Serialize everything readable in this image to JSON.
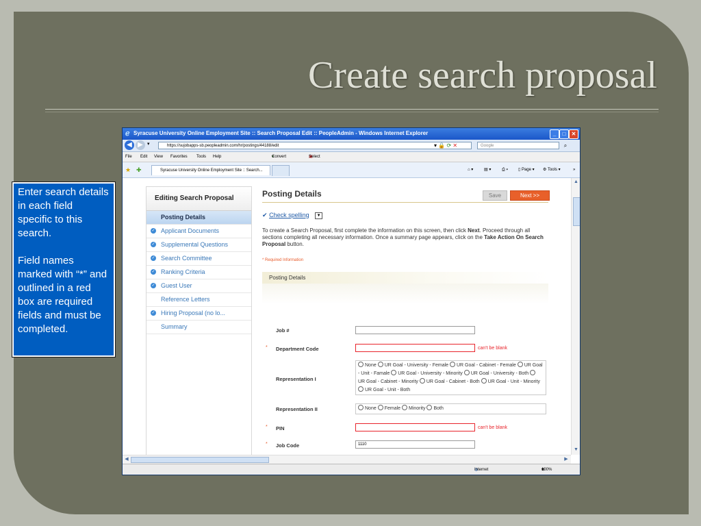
{
  "slide": {
    "title": "Create search proposal",
    "callout": {
      "para1": "Enter search details in each field specific to this search.",
      "para2": "Field names marked with “*” and outlined in a red box are required fields and must be completed."
    }
  },
  "browser": {
    "window_title": "Syracuse University Online Employment Site :: Search Proposal Edit :: PeopleAdmin - Windows Internet Explorer",
    "url": "https://sujobapps-sb.peopleadmin.com/hr/postings/44188/edit",
    "search_placeholder": "Google",
    "menu": [
      "File",
      "Edit",
      "View",
      "Favorites",
      "Tools",
      "Help"
    ],
    "convert_label": "Convert",
    "select_label": "Select",
    "tab_label": "Syracuse University Online Employment Site :: Search...",
    "commands": {
      "page": "Page",
      "tools": "Tools"
    },
    "status": {
      "zone": "Internet",
      "zoom": "100%"
    }
  },
  "sidenav": {
    "header": "Editing Search Proposal",
    "items": [
      {
        "label": "Posting Details",
        "state": "active"
      },
      {
        "label": "Applicant Documents",
        "state": "done"
      },
      {
        "label": "Supplemental Questions",
        "state": "done"
      },
      {
        "label": "Search Committee",
        "state": "done"
      },
      {
        "label": "Ranking Criteria",
        "state": "done"
      },
      {
        "label": "Guest User",
        "state": "done"
      },
      {
        "label": "Reference Letters",
        "state": "plain"
      },
      {
        "label": "Hiring Proposal (no lo...",
        "state": "done"
      },
      {
        "label": "Summary",
        "state": "plain"
      }
    ]
  },
  "main": {
    "title": "Posting Details",
    "save_label": "Save",
    "next_label": "Next >>",
    "spell_label": "Check spelling",
    "intro_a": "To create a Search Proposal, first complete the information on this screen, then click ",
    "intro_b": "Next",
    "intro_c": ". Proceed through all sections completing all necessary information. Once a summary page appears, click on the ",
    "intro_d": "Take Action On Search Proposal",
    "intro_e": " button.",
    "required_note": "* Required Information",
    "section_label": "Posting Details",
    "fields": {
      "job": {
        "label": "Job #",
        "value": ""
      },
      "dept": {
        "label": "Department Code",
        "value": "",
        "error": "can't be blank"
      },
      "rep1": {
        "label": "Representation I",
        "options": [
          "None",
          "UR Goal - University - Female",
          "UR Goal - Cabinet - Female",
          "UR Goal - Unit - Famale",
          "UR Goal - University - Minority",
          "UR Goal - University - Both",
          "UR Goal - Cabinet - Minority",
          "UR Goal - Cabinet - Both",
          "UR Goal - Unit - Minority",
          "UR Goal - Unit - Both"
        ]
      },
      "rep2": {
        "label": "Representation II",
        "options": [
          "None",
          "Female",
          "Minority",
          "Both"
        ]
      },
      "pin": {
        "label": "PIN",
        "value": "",
        "error": "can't be blank"
      },
      "jobcode": {
        "label": "Job Code",
        "value": "1110"
      }
    }
  }
}
